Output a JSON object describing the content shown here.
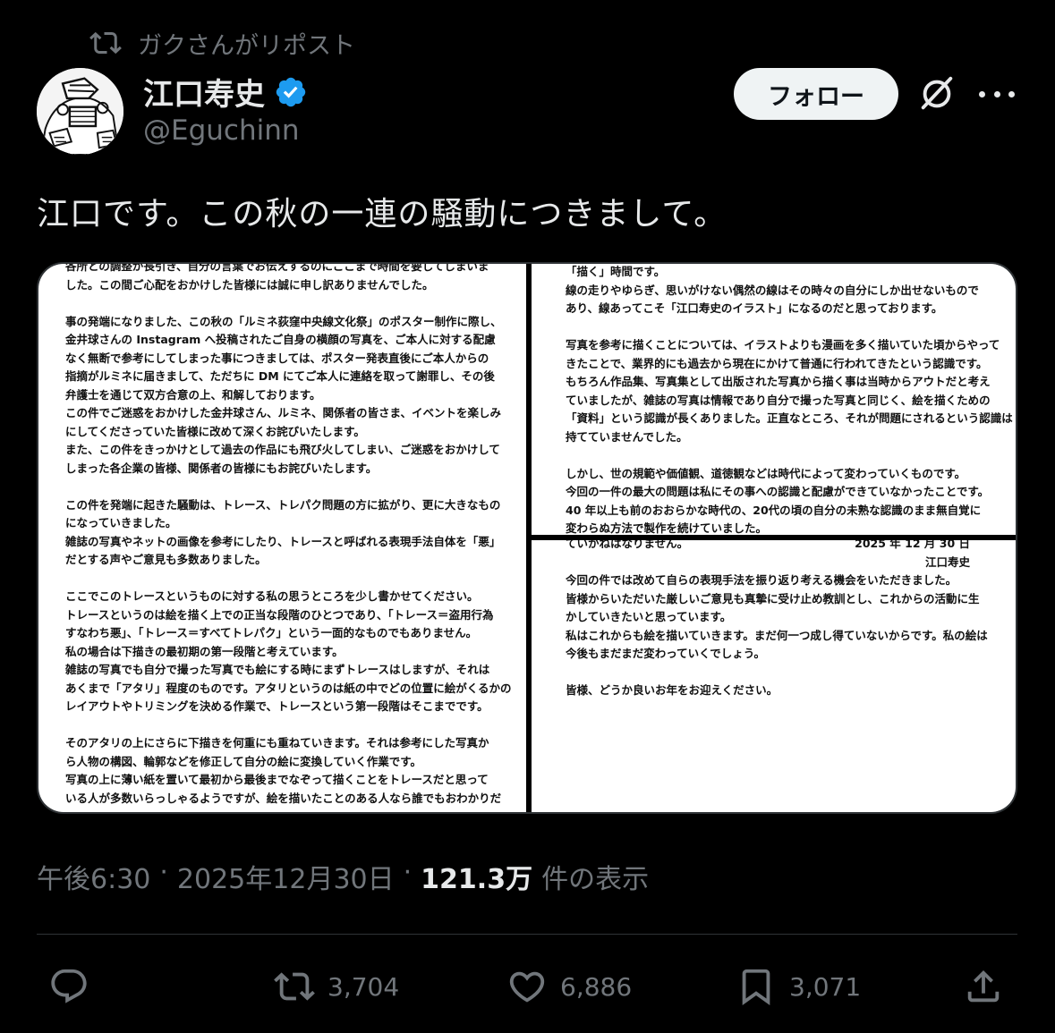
{
  "repost": {
    "text": "ガクさんがリポスト"
  },
  "author": {
    "name": "江口寿史",
    "handle": "@Eguchinn",
    "follow_label": "フォロー"
  },
  "tweet": {
    "text": "江口です。この秋の一連の騒動につきまして。"
  },
  "images": {
    "left": [
      "各所との調整が長引き、自分の言葉でお伝えするのにここまで時間を要してしまいま",
      "した。この間ご心配をおかけした皆様には誠に申し訳ありませんでした。",
      "",
      "事の発端になりました、この秋の「ルミネ荻窪中央線文化祭」のポスター制作に際し、",
      "金井球さんの Instagram へ投稿されたご自身の横顔の写真を、ご本人に対する配慮",
      "なく無断で参考にしてしまった事につきましては、ポスター発表直後にご本人からの",
      "指摘がルミネに届きまして、ただちに DM にてご本人に連絡を取って謝罪し、その後",
      "弁護士を通じて双方合意の上、和解しております。",
      "この件でご迷惑をおかけした金井球さん、ルミネ、関係者の皆さま、イベントを楽しみ",
      "にしてくださっていた皆様に改めて深くお詫びいたします。",
      "また、この件をきっかけとして過去の作品にも飛び火してしまい、ご迷惑をおかけして",
      "しまった各企業の皆様、関係者の皆様にもお詫びいたします。",
      "",
      "この件を発端に起きた騒動は、トレース、トレパク問題の方に拡がり、更に大きなもの",
      "になっていきました。",
      "雑誌の写真やネットの画像を参考にしたり、トレースと呼ばれる表現手法自体を「悪」",
      "だとする声やご意見も多数ありました。",
      "",
      "ここでこのトレースというものに対する私の思うところを少し書かせてください。",
      "トレースというのは絵を描く上での正当な段階のひとつであり、「トレース＝盗用行為",
      "すなわち悪」、「トレース＝すべてトレパク」という一面的なものでもありません。",
      "私の場合は下描きの最初期の第一段階と考えています。",
      "雑誌の写真でも自分で撮った写真でも絵にする時にまずトレースはしますが、それは",
      "あくまで「アタリ」程度のものです。アタリというのは紙の中でどの位置に絵がくるかの",
      "レイアウトやトリミングを決める作業で、トレースという第一段階はそこまでです。",
      "",
      "そのアタリの上にさらに下描きを何重にも重ねていきます。それは参考にした写真か",
      "ら人物の構図、輪郭などを修正して自分の絵に変換していく作業です。",
      "写真の上に薄い紙を置いて最初から最後までなぞって描くことをトレースだと思って",
      "いる人が多数いらっしゃるようですが、絵を描いたことのある人なら誰でもおわかりだ"
    ],
    "top_right": [
      "「描く」時間です。",
      "線の走りやゆらぎ、思いがけない偶然の線はその時々の自分にしか出せないもので",
      "あり、線あってこそ「江口寿史のイラスト」になるのだと思っております。",
      "",
      "写真を参考に描くことについては、イラストよりも漫画を多く描いていた頃からやって",
      "きたことで、業界的にも過去から現在にかけて普通に行われてきたという認識です。",
      "もちろん作品集、写真集として出版された写真から描く事は当時からアウトだと考え",
      "ていましたが、雑誌の写真は情報であり自分で撮った写真と同じく、絵を描くための",
      "「資料」という認識が長くありました。正直なところ、それが問題にされるという認識は",
      "持てていませんでした。",
      "",
      "しかし、世の規範や価値観、道徳観などは時代によって変わっていくものです。",
      "今回の一件の最大の問題は私にその事への認識と配慮ができていなかったことです。",
      "40 年以上も前のおおらかな時代の、20代の頃の自分の未熟な認識のまま無自覚に",
      "変わらぬ方法で製作を続けていました。"
    ],
    "bottom_right": [
      "ていかねはなりません。",
      "",
      "今回の件では改めて自らの表現手法を振り返り考える機会をいただきました。",
      "皆様からいただいた厳しいご意見も真摯に受け止め教訓とし、これからの活動に生",
      "かしていきたいと思っています。",
      "私はこれからも絵を描いていきます。まだ何一つ成し得ていないからです。私の絵は",
      "今後もまだまだ変わっていくでしょう。",
      "",
      "皆様、どうか良いお年をお迎えください。"
    ],
    "signature_date": "2025 年 12 月 30 日",
    "signature_name": "江口寿史"
  },
  "meta": {
    "time": "午後6:30",
    "dot1": "·",
    "date": "2025年12月30日",
    "dot2": "·",
    "views_count": "121.3万",
    "views_label": "件の表示"
  },
  "actions": {
    "replies": "",
    "reposts": "3,704",
    "likes": "6,886",
    "bookmarks": "3,071"
  },
  "colors": {
    "background": "#000000",
    "text": "#e7e9ea",
    "muted": "#71767b",
    "verified": "#1d9bf0",
    "follow_bg": "#eff3f4"
  },
  "icons": [
    "repost-icon",
    "verified-badge-icon",
    "grok-icon",
    "more-icon",
    "reply-icon",
    "like-icon",
    "bookmark-icon",
    "share-icon"
  ]
}
